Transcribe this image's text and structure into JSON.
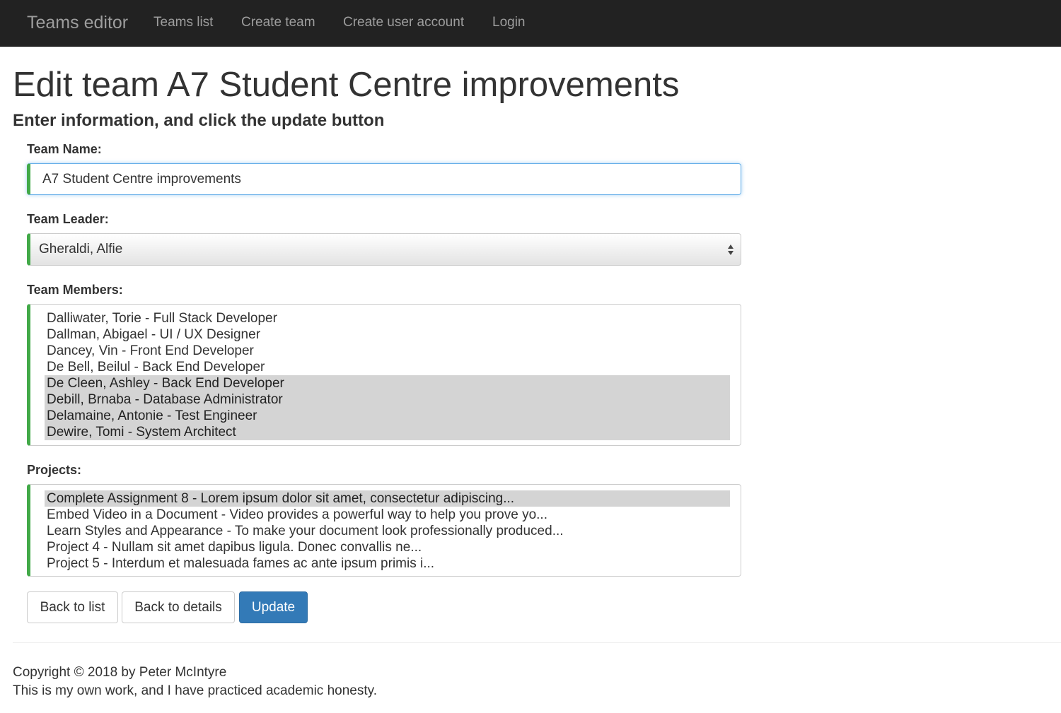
{
  "navbar": {
    "brand": "Teams editor",
    "links": [
      "Teams list",
      "Create team",
      "Create user account",
      "Login"
    ]
  },
  "page": {
    "title": "Edit team A7 Student Centre improvements",
    "subtitle": "Enter information, and click the update button"
  },
  "form": {
    "team_name": {
      "label": "Team Name:",
      "value": "A7 Student Centre improvements"
    },
    "team_leader": {
      "label": "Team Leader:",
      "selected": "Gheraldi, Alfie"
    },
    "team_members": {
      "label": "Team Members:",
      "options": [
        {
          "text": "Dalliwater, Torie - Full Stack Developer",
          "selected": false
        },
        {
          "text": "Dallman, Abigael - UI / UX Designer",
          "selected": false
        },
        {
          "text": "Dancey, Vin - Front End Developer",
          "selected": false
        },
        {
          "text": "De Bell, Beilul - Back End Developer",
          "selected": false
        },
        {
          "text": "De Cleen, Ashley - Back End Developer",
          "selected": true
        },
        {
          "text": "Debill, Brnaba - Database Administrator",
          "selected": true
        },
        {
          "text": "Delamaine, Antonie - Test Engineer",
          "selected": true
        },
        {
          "text": "Dewire, Tomi - System Architect",
          "selected": true
        }
      ]
    },
    "projects": {
      "label": "Projects:",
      "options": [
        {
          "text": "Complete Assignment 8 - Lorem ipsum dolor sit amet, consectetur adipiscing...",
          "selected": true
        },
        {
          "text": "Embed Video in a Document - Video provides a powerful way to help you prove yo...",
          "selected": false
        },
        {
          "text": "Learn Styles and Appearance - To make your document look professionally produced...",
          "selected": false
        },
        {
          "text": "Project 4 - Nullam sit amet dapibus ligula. Donec convallis ne...",
          "selected": false
        },
        {
          "text": "Project 5 - Interdum et malesuada fames ac ante ipsum primis i...",
          "selected": false
        }
      ]
    },
    "buttons": {
      "back_to_list": "Back to list",
      "back_to_details": "Back to details",
      "update": "Update"
    }
  },
  "footer": {
    "copyright": "Copyright © 2018 by Peter McIntyre",
    "honesty": "This is my own work, and I have practiced academic honesty."
  },
  "colors": {
    "navbar_bg": "#222222",
    "nav_text": "#9d9d9d",
    "valid_border": "#42a948",
    "primary": "#337ab7",
    "selected_option": "#d4d4d4"
  }
}
